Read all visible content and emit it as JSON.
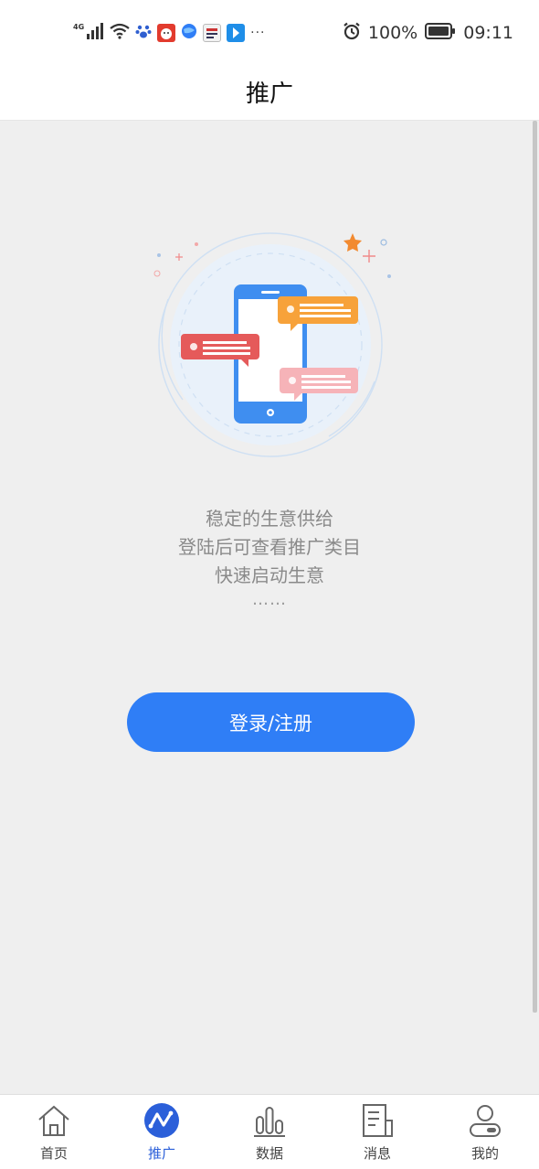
{
  "status_bar": {
    "network": "4G",
    "battery": "100%",
    "time": "09:11",
    "more": "···",
    "icons": [
      "signal-icon",
      "wifi-icon",
      "baidu-paw-icon",
      "red-app-icon",
      "globe-app-icon",
      "news-app-icon",
      "blue-app-icon",
      "alarm-icon",
      "battery-icon"
    ]
  },
  "header": {
    "title": "推广"
  },
  "main": {
    "illustration": "chat-phone-illustration",
    "lines": [
      "稳定的生意供给",
      "登陆后可查看推广类目",
      "快速启动生意"
    ],
    "ellipsis": "……",
    "login_label": "登录/注册",
    "accent_color": "#2f7ef6"
  },
  "tabs": [
    {
      "label": "首页",
      "icon": "home-icon",
      "active": false
    },
    {
      "label": "推广",
      "icon": "promote-icon",
      "active": true
    },
    {
      "label": "数据",
      "icon": "bar-chart-icon",
      "active": false
    },
    {
      "label": "消息",
      "icon": "message-doc-icon",
      "active": false
    },
    {
      "label": "我的",
      "icon": "profile-icon",
      "active": false
    }
  ]
}
